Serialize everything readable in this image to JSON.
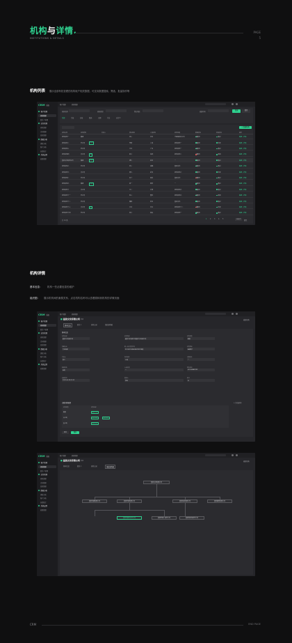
{
  "hero": {
    "title_a": "机构",
    "title_amp": "与",
    "title_b": "详情.",
    "subtitle": "INSTITUTIONS & DETAILS",
    "page_label": "PAGE",
    "page_num": "5"
  },
  "section1": {
    "title": "机构列表",
    "desc": "展示全部有权查看的机构帐户相关数据，可支持数据搜索、筛选、批量操作等"
  },
  "section2": {
    "title": "机构详情",
    "basic_label": "基本信息：",
    "basic_text": "机构一些必要信息的维护",
    "org_label": "组织图：",
    "org_text": "展示机构间的隶属关系，点击机构名称可以查看跳转到机构的详情页面"
  },
  "app": {
    "logo": "CRM",
    "logo_sub": "系统",
    "sidebar": [
      {
        "type": "group",
        "label": "客户管理"
      },
      {
        "type": "item",
        "label": "机构管理",
        "active": true
      },
      {
        "type": "item",
        "label": "联系人管理"
      },
      {
        "type": "group",
        "label": "业务管理"
      },
      {
        "type": "item",
        "label": "商机管理"
      },
      {
        "type": "item",
        "label": "合同管理"
      },
      {
        "type": "item",
        "label": "回款管理"
      },
      {
        "type": "group",
        "label": "数据分析"
      },
      {
        "type": "item",
        "label": "销售分析"
      },
      {
        "type": "item",
        "label": "客户分析"
      },
      {
        "type": "item",
        "label": "业绩统计"
      },
      {
        "type": "group",
        "label": "系统设置"
      },
      {
        "type": "item",
        "label": "权限管理"
      }
    ],
    "breadcrumb": [
      "客户管理",
      "机构管理"
    ],
    "search_placeholder": "搜索机构"
  },
  "list": {
    "filters": [
      {
        "label": "机构名称",
        "value": ""
      },
      {
        "label": "机构类型",
        "value": "全部"
      },
      {
        "label": "所在地区",
        "value": "全部"
      },
      {
        "label": "创建时间",
        "value": ""
      }
    ],
    "filter_chips": [
      "全部",
      "生效",
      "失效",
      "筛选",
      "已删",
      "行业",
      "自定义"
    ],
    "query": "查询",
    "reset": "重置",
    "new_btn": "+ 新建机构",
    "columns": [
      "机构名称",
      "机构类型",
      "负责人",
      "所在地区",
      "上级机构",
      "机构等级",
      "数据状态",
      "审核状态",
      "操作"
    ],
    "rows": [
      {
        "name": "机构名称一",
        "type": "集团",
        "tag": "",
        "owner": "张三",
        "region": "北京",
        "parent": "华夏保险总公司",
        "level": "A级",
        "status": "启用",
        "audit": "通过",
        "color": "#2fd08f"
      },
      {
        "name": "机构名称二",
        "type": "分公司",
        "tag": "重点",
        "owner": "李四",
        "region": "上海",
        "parent": "机构名称一",
        "level": "B级",
        "status": "启用",
        "audit": "待审",
        "color": "#2fd08f"
      },
      {
        "name": "机构名称三",
        "type": "分公司",
        "tag": "",
        "owner": "王五",
        "region": "广州",
        "parent": "机构名称一",
        "level": "B级",
        "status": "启用",
        "audit": "通过",
        "color": "#2fd08f"
      },
      {
        "name": "机构名称四",
        "type": "支公司",
        "tag": "新",
        "owner": "赵六",
        "region": "深圳",
        "parent": "机构名称二",
        "level": "C级",
        "status": "停用",
        "audit": "驳回",
        "color": "#e05555"
      },
      {
        "name": "星辰文化有限公司",
        "type": "集团",
        "tag": "重点",
        "owner": "钱七",
        "region": "杭州",
        "parent": "—",
        "level": "A级",
        "status": "启用",
        "audit": "通过",
        "color": "#2fd08f"
      },
      {
        "name": "机构名称六",
        "type": "分公司",
        "tag": "",
        "owner": "孙八",
        "region": "成都",
        "parent": "星辰文化",
        "level": "B级",
        "status": "启用",
        "audit": "通过",
        "color": "#2fd08f"
      },
      {
        "name": "机构名称七",
        "type": "支公司",
        "tag": "",
        "owner": "周九",
        "region": "武汉",
        "parent": "机构名称六",
        "level": "C级",
        "status": "启用",
        "audit": "待审",
        "color": "#2fd08f"
      },
      {
        "name": "机构名称八",
        "type": "分公司",
        "tag": "",
        "owner": "吴十",
        "region": "南京",
        "parent": "星辰文化",
        "level": "B级",
        "status": "停用",
        "audit": "通过",
        "color": "#e05555"
      },
      {
        "name": "机构名称九",
        "type": "集团",
        "tag": "重点",
        "owner": "郑一",
        "region": "西安",
        "parent": "—",
        "level": "A级",
        "status": "启用",
        "audit": "通过",
        "color": "#2fd08f"
      },
      {
        "name": "机构名称十",
        "type": "支公司",
        "tag": "",
        "owner": "冯二",
        "region": "天津",
        "parent": "机构名称九",
        "level": "C级",
        "status": "启用",
        "audit": "通过",
        "color": "#2fd08f"
      },
      {
        "name": "机构名称十一",
        "type": "分公司",
        "tag": "",
        "owner": "陈三",
        "region": "重庆",
        "parent": "机构名称九",
        "level": "B级",
        "status": "启用",
        "audit": "驳回",
        "color": "#2fd08f"
      },
      {
        "name": "机构名称十二",
        "type": "分公司",
        "tag": "",
        "owner": "褚四",
        "region": "苏州",
        "parent": "星辰文化",
        "level": "B级",
        "status": "启用",
        "audit": "通过",
        "color": "#2fd08f"
      },
      {
        "name": "机构名称十三",
        "type": "支公司",
        "tag": "新",
        "owner": "卫五",
        "region": "长沙",
        "parent": "机构名称十二",
        "level": "C级",
        "status": "停用",
        "audit": "待审",
        "color": "#e05555"
      },
      {
        "name": "机构名称十四",
        "type": "分公司",
        "tag": "",
        "owner": "蒋六",
        "region": "青岛",
        "parent": "机构名称一",
        "level": "B级",
        "status": "启用",
        "audit": "通过",
        "color": "#2fd08f"
      }
    ],
    "action": "编辑 | 详情",
    "footer_left": "共 14 条",
    "pages": [
      "1",
      "2",
      "3",
      "4",
      "5"
    ],
    "page_size": "10条/页",
    "goto": "跳至"
  },
  "detail": {
    "title": "星辰文化有限公司",
    "title_tag": "集团",
    "edit": "编辑机构",
    "tabs": [
      "基本信息",
      "联系人",
      "商机记录",
      "组织架构图"
    ],
    "section_basic": "基本信息",
    "fields": [
      {
        "label": "机构名称",
        "value": "星辰文化有限公司"
      },
      {
        "label": "机构简称",
        "value": "星辰文化有限公司星辰文化有限公司"
      },
      {
        "label": "机构类型",
        "value": "集团"
      },
      {
        "label": "所属行业",
        "value": "文化传媒"
      },
      {
        "label": "统一社会信用代码",
        "value": "91310115MA1K4XXXX1缺失"
      },
      {
        "label": "机构等级",
        "value": "A级客户"
      },
      {
        "label": "负责人",
        "value": "张三"
      },
      {
        "label": "所在地区",
        "value": "上海"
      },
      {
        "label": "详细地址",
        "value": "—"
      },
      {
        "label": "数据状态",
        "value": "启用"
      },
      {
        "label": "上级机构",
        "value": "—"
      },
      {
        "label": "联系电话",
        "value": "021-5888XXXX"
      },
      {
        "label": "创建时间",
        "value": "2022-06-18 09:32"
      },
      {
        "label": "更新人",
        "value": "李四"
      },
      {
        "label": "备注",
        "value": "无"
      }
    ],
    "section_contacts": "关联机构配置",
    "contact_action": "+ 添加机构",
    "contact_cols": [
      "机构类型",
      "机构名称"
    ],
    "contact_rows": [
      {
        "type": "集团",
        "tags": [
          "星辰文化"
        ]
      },
      {
        "type": "分公司",
        "tags": [
          "星辰传媒",
          "星辰影视"
        ]
      },
      {
        "type": "支公司",
        "tags": [
          "星辰科技"
        ]
      }
    ],
    "cancel": "取消",
    "save": "保存"
  },
  "org": {
    "root": "星辰文化有限公司",
    "level2": [
      "星辰传媒有限公司",
      "星辰影视有限公司",
      "星辰科技有限公司",
      "星辰教育有限公司"
    ],
    "level3": [
      "星辰传媒北京分公司",
      "星辰影视上海分公司",
      "星辰科技深圳分公司"
    ]
  },
  "footer": {
    "left": "CRM",
    "right": "END PAGE"
  }
}
